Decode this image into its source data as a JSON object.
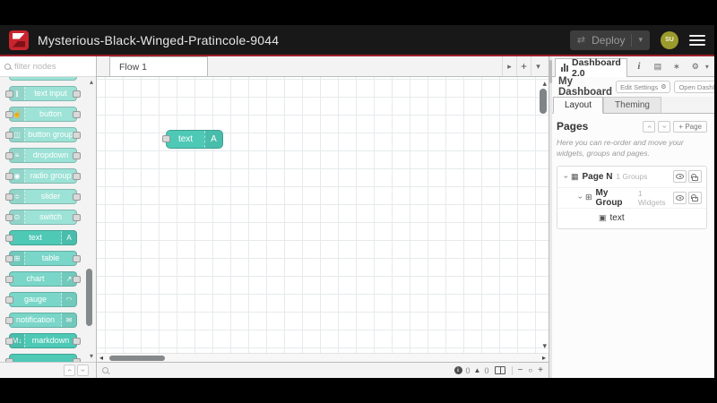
{
  "header": {
    "title": "Mysterious-Black-Winged-Pratincole-9044",
    "deploy_label": "Deploy",
    "deploy_caret": "▾",
    "avatar_initials": "SU"
  },
  "palette": {
    "search_placeholder": "filter nodes",
    "nodes": [
      {
        "label": "text input",
        "glyph": "I"
      },
      {
        "label": "button",
        "glyph": "☝"
      },
      {
        "label": "button group",
        "glyph": "◫"
      },
      {
        "label": "dropdown",
        "glyph": "≡"
      },
      {
        "label": "radio group",
        "glyph": "◉"
      },
      {
        "label": "slider",
        "glyph": "≑"
      },
      {
        "label": "switch",
        "glyph": "⊙"
      },
      {
        "label": "text",
        "glyph": "A"
      },
      {
        "label": "table",
        "glyph": "⊞"
      },
      {
        "label": "chart",
        "glyph": "↗"
      },
      {
        "label": "gauge",
        "glyph": "◠"
      },
      {
        "label": "notification",
        "glyph": "✉"
      },
      {
        "label": "markdown",
        "glyph": "M↓"
      }
    ],
    "scroll_up": "▴",
    "scroll_down": "▾"
  },
  "workspace": {
    "tab_label": "Flow 1",
    "tab_next": "▸",
    "tab_add": "+",
    "tab_list": "▾",
    "node_label": "text",
    "node_glyph": "A",
    "hscroll_left": "◂",
    "hscroll_right": "▸",
    "vscroll_up": "▴",
    "vscroll_down": "▾",
    "footer": {
      "info_glyph": "i",
      "info_count": "0",
      "warn_glyph": "▲",
      "warn_count": "0",
      "zoom_out": "−",
      "zoom_reset": "○",
      "zoom_in": "+"
    }
  },
  "sidebar": {
    "tab_label": "Dashboard 2.0",
    "caret": "▾",
    "title": "My Dashboard",
    "edit_settings_label": "Edit Settings",
    "edit_settings_glyph": "⚙",
    "open_dashboard_label": "Open Dashboard",
    "open_dashboard_glyph": "⧉",
    "tab_layout": "Layout",
    "tab_theming": "Theming",
    "pages": {
      "heading": "Pages",
      "add_page_label": "+ Page",
      "description": "Here you can re-order and move your widgets, groups and pages.",
      "tree": [
        {
          "icon": "▦",
          "label": "Page N",
          "meta": "1 Groups"
        },
        {
          "icon": "⊞",
          "label": "My Group",
          "meta": "1 Widgets"
        },
        {
          "icon": "▣",
          "label": "text",
          "meta": ""
        }
      ]
    }
  },
  "colors": {
    "node_light": "#9ce2d6",
    "node_mid": "#79d6c8",
    "node_dark": "#4ec9b6",
    "header_accent": "#9b1f28",
    "brand_red": "#c9252d",
    "avatar_olive": "#9b9a2d"
  }
}
